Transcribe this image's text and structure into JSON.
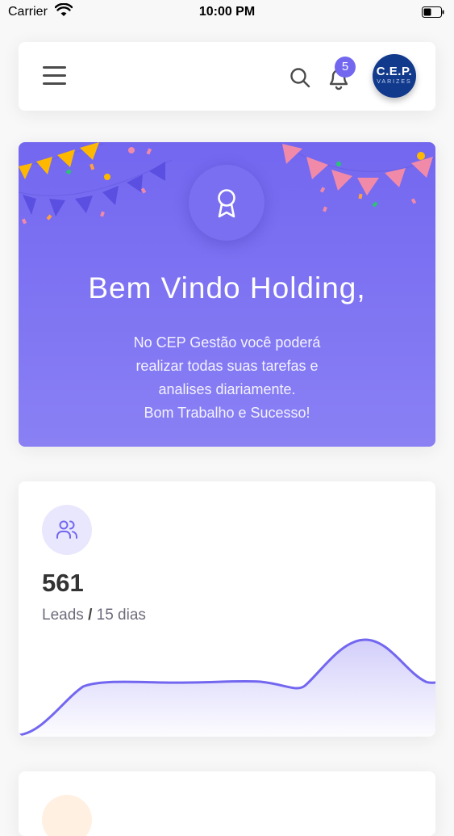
{
  "status_bar": {
    "carrier": "Carrier",
    "time": "10:00 PM"
  },
  "navbar": {
    "notification_count": "5",
    "avatar": {
      "logo_main": "C.E.P.",
      "logo_sub": "VARIZES"
    }
  },
  "welcome": {
    "title": "Bem Vindo Holding,",
    "lines": [
      "No CEP Gestão você poderá",
      "realizar todas suas tarefas e",
      "analises diariamente.",
      "Bom Trabalho e Sucesso!"
    ]
  },
  "leads": {
    "value": "561",
    "label_main": "Leads",
    "label_sep": "/",
    "label_period": "15 dias"
  },
  "colors": {
    "primary": "#7367f0",
    "badge": "#7367f0",
    "warning_light": "#fff0e1"
  },
  "icons": {
    "menu": "hamburger-icon",
    "search": "search-icon",
    "bell": "bell-icon",
    "award": "award-icon",
    "users": "users-icon"
  }
}
